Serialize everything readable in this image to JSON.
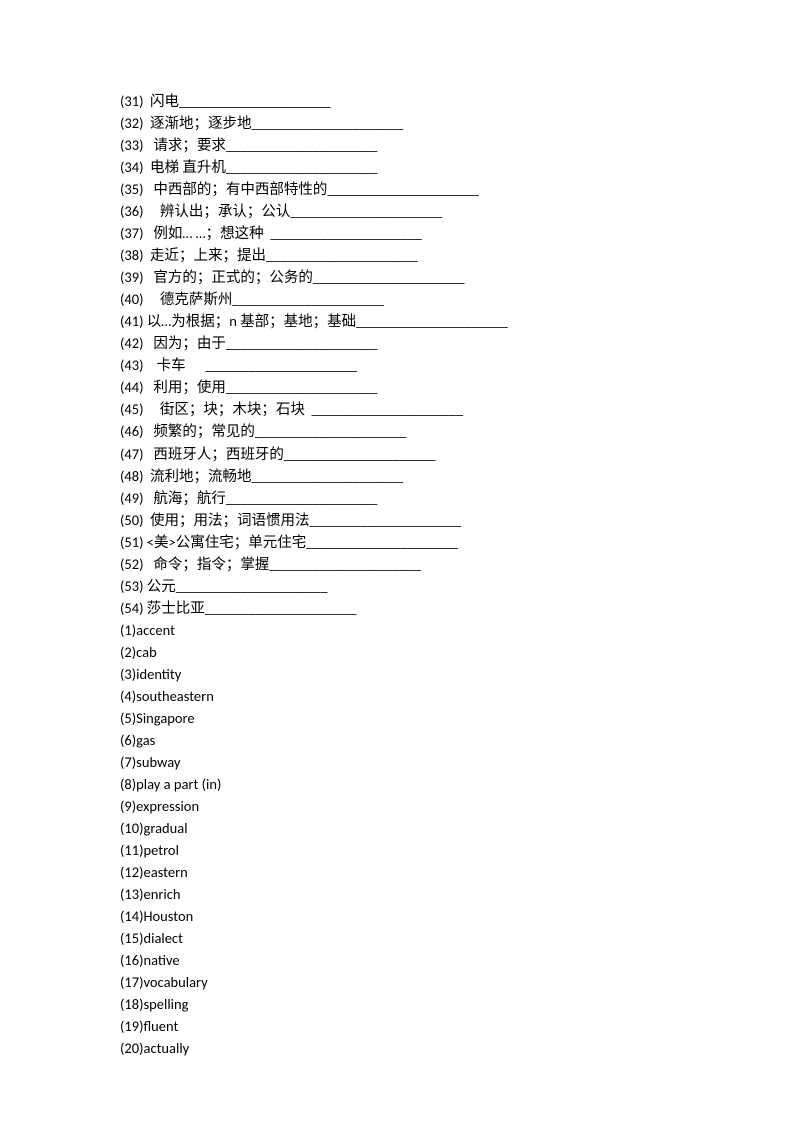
{
  "fill_items": [
    {
      "num": "(31)",
      "text": "  闪电_____________________"
    },
    {
      "num": "(32)",
      "text": "  逐渐地；逐步地_____________________"
    },
    {
      "num": "(33)",
      "text": "   请求；要求_____________________"
    },
    {
      "num": "(34)",
      "text": "  电梯 直升机_____________________"
    },
    {
      "num": "(35)",
      "text": "   中西部的；有中西部特性的_____________________"
    },
    {
      "num": "(36)",
      "text": "     辨认出；承认；公认_____________________"
    },
    {
      "num": "(37)",
      "text": "   例如… …；想这种  _____________________"
    },
    {
      "num": "(38)",
      "text": "  走近；上来；提出_____________________"
    },
    {
      "num": "(39)",
      "text": "   官方的；正式的；公务的_____________________"
    },
    {
      "num": "(40)",
      "text": "     德克萨斯州_____________________"
    },
    {
      "num": "(41)",
      "text": " 以…为根据；n 基部；基地；基础_____________________"
    },
    {
      "num": "(42)",
      "text": "   因为；由于_____________________"
    },
    {
      "num": "(43)",
      "text": "    卡车      _____________________"
    },
    {
      "num": "(44)",
      "text": "   利用；使用_____________________"
    },
    {
      "num": "(45)",
      "text": "     街区；块；木块；石块  _____________________"
    },
    {
      "num": "(46)",
      "text": "   频繁的；常见的_____________________"
    },
    {
      "num": "(47)",
      "text": "   西班牙人；西班牙的_____________________"
    },
    {
      "num": "(48)",
      "text": "  流利地；流畅地_____________________"
    },
    {
      "num": "(49)",
      "text": "   航海；航行_____________________"
    },
    {
      "num": "(50)",
      "text": "  使用；用法；词语惯用法_____________________"
    },
    {
      "num": "(51)",
      "text": " <美>公寓住宅；单元住宅_____________________"
    },
    {
      "num": "(52)",
      "text": "   命令；指令；掌握_____________________"
    },
    {
      "num": "(53)",
      "text": " 公元_____________________"
    },
    {
      "num": "(54)",
      "text": " 莎士比亚_____________________"
    }
  ],
  "answers": [
    {
      "num": "(1)",
      "text": "accent"
    },
    {
      "num": "(2)",
      "text": "cab"
    },
    {
      "num": "(3)",
      "text": "identity"
    },
    {
      "num": "(4)",
      "text": "southeastern"
    },
    {
      "num": "(5)",
      "text": "Singapore"
    },
    {
      "num": "(6)",
      "text": "gas"
    },
    {
      "num": "(7)",
      "text": "subway"
    },
    {
      "num": "(8)",
      "text": "play a part (in)"
    },
    {
      "num": "(9)",
      "text": "expression"
    },
    {
      "num": "(10)",
      "text": "gradual"
    },
    {
      "num": "(11)",
      "text": "petrol"
    },
    {
      "num": "(12)",
      "text": "eastern"
    },
    {
      "num": "(13)",
      "text": "enrich"
    },
    {
      "num": "(14)",
      "text": "Houston"
    },
    {
      "num": "(15)",
      "text": "dialect"
    },
    {
      "num": "(16)",
      "text": "native"
    },
    {
      "num": "(17)",
      "text": "vocabulary"
    },
    {
      "num": "(18)",
      "text": "spelling"
    },
    {
      "num": "(19)",
      "text": "fluent"
    },
    {
      "num": "(20)",
      "text": "actually"
    }
  ]
}
